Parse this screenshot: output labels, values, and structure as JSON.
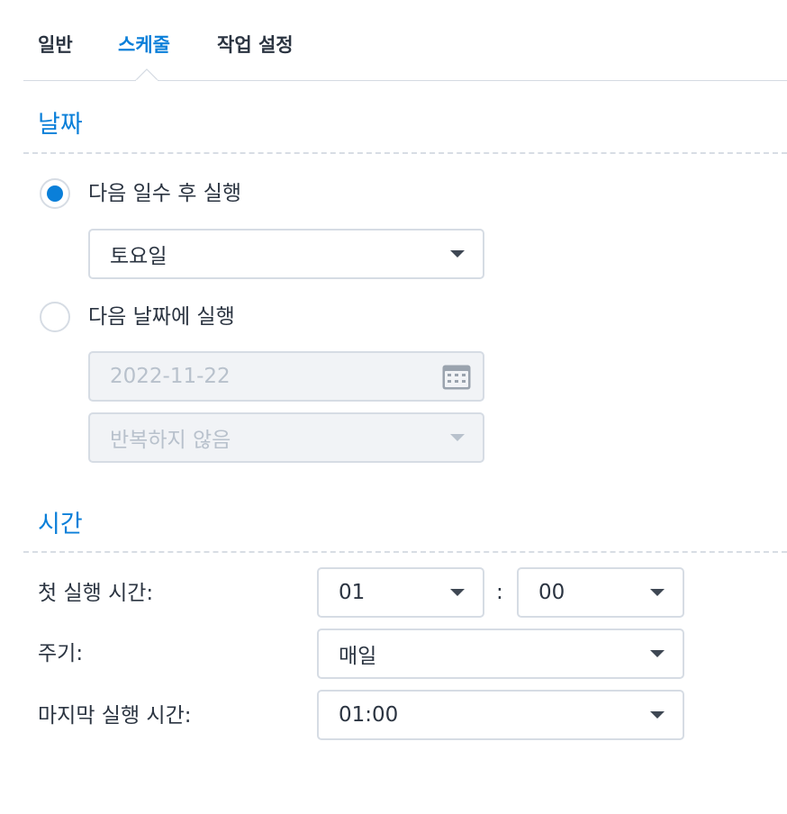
{
  "tabs": {
    "general": "일반",
    "schedule": "스케줄",
    "task_settings": "작업 설정"
  },
  "date_section": {
    "title": "날짜",
    "run_after_days_label": "다음 일수 후 실행",
    "run_after_days_checked": true,
    "day_select_value": "토요일",
    "run_on_date_label": "다음 날짜에 실행",
    "run_on_date_checked": false,
    "date_value": "2022-11-22",
    "repeat_value": "반복하지 않음"
  },
  "time_section": {
    "title": "시간",
    "first_run_label": "첫 실행 시간:",
    "first_run_hour": "01",
    "time_separator": ":",
    "first_run_minute": "00",
    "frequency_label": "주기:",
    "frequency_value": "매일",
    "last_run_label": "마지막 실행 시간:",
    "last_run_value": "01:00"
  },
  "colors": {
    "accent": "#0a7fd9",
    "text": "#2b3441",
    "border": "#d6dce4",
    "disabled_bg": "#f1f3f6",
    "disabled_text": "#b8c1cc"
  },
  "icons": {
    "dropdown": "chevron-down-icon",
    "calendar": "calendar-icon"
  }
}
